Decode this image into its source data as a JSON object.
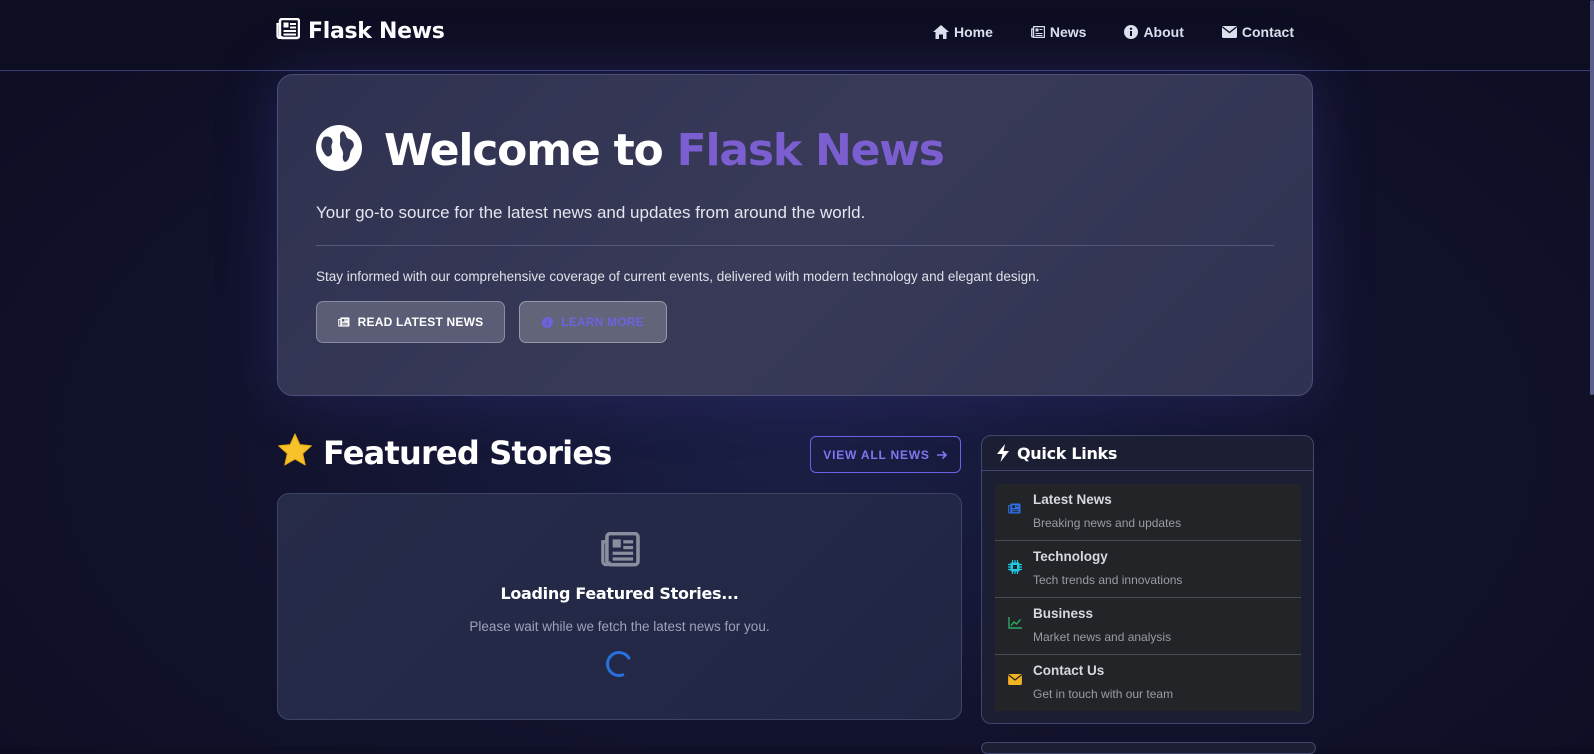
{
  "navbar": {
    "brand": "Flask News",
    "items": [
      {
        "label": "Home",
        "icon": "home-icon"
      },
      {
        "label": "News",
        "icon": "newspaper-icon"
      },
      {
        "label": "About",
        "icon": "info-icon"
      },
      {
        "label": "Contact",
        "icon": "envelope-icon"
      }
    ]
  },
  "hero": {
    "title_prefix": "Welcome to",
    "title_accent": "Flask News",
    "subtitle": "Your go-to source for the latest news and updates from around the world.",
    "body": "Stay informed with our comprehensive coverage of current events, delivered with modern technology and elegant design.",
    "read_button": "READ LATEST NEWS",
    "learn_button": "LEARN MORE"
  },
  "featured": {
    "title": "Featured Stories",
    "view_all": "VIEW ALL NEWS",
    "loading_title": "Loading Featured Stories...",
    "loading_text": "Please wait while we fetch the latest news for you."
  },
  "quick_links": {
    "title": "Quick Links",
    "items": [
      {
        "title": "Latest News",
        "subtitle": "Breaking news and updates",
        "icon": "newspaper-icon",
        "color": "#2f6fe8"
      },
      {
        "title": "Technology",
        "subtitle": "Tech trends and innovations",
        "icon": "chip-icon",
        "color": "#1fc8e0"
      },
      {
        "title": "Business",
        "subtitle": "Market news and analysis",
        "icon": "chart-line-icon",
        "color": "#2aa860"
      },
      {
        "title": "Contact Us",
        "subtitle": "Get in touch with our team",
        "icon": "envelope-icon",
        "color": "#f2b420"
      }
    ]
  },
  "colors": {
    "accent": "#7b5fd0",
    "link": "#6a63e6",
    "background": "#12132e"
  }
}
